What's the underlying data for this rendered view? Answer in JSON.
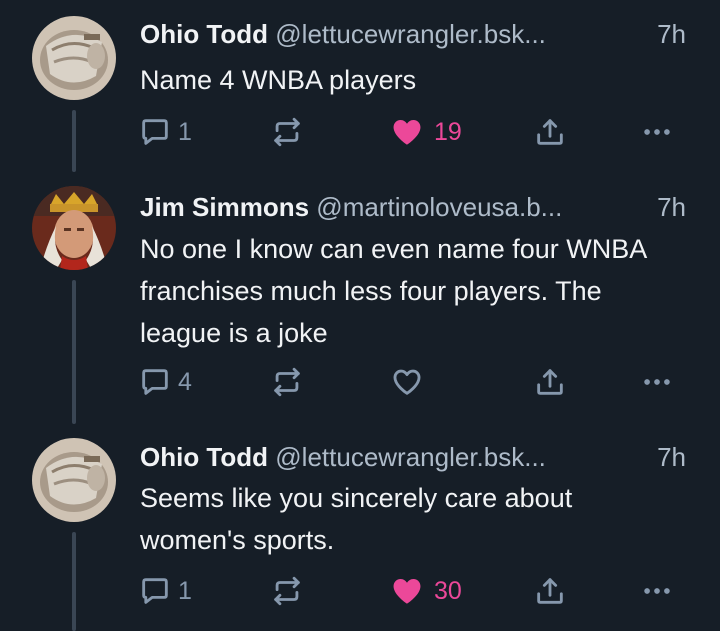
{
  "posts": [
    {
      "author": {
        "display_name": "Ohio Todd",
        "handle": "@lettucewrangler.bsk...",
        "avatar_icon": "avatar-icon"
      },
      "time": "7h",
      "text": "Name 4 WNBA players",
      "stats": {
        "replies": "1",
        "reposts": "",
        "likes": "19",
        "liked": true
      }
    },
    {
      "author": {
        "display_name": "Jim Simmons",
        "handle": "@martinoloveusa.b...",
        "avatar_icon": "avatar-icon"
      },
      "time": "7h",
      "text": "No one I know can even name four WNBA franchises much less four players. The league is a joke",
      "stats": {
        "replies": "4",
        "reposts": "",
        "likes": "",
        "liked": false
      }
    },
    {
      "author": {
        "display_name": "Ohio Todd",
        "handle": "@lettucewrangler.bsk...",
        "avatar_icon": "avatar-icon"
      },
      "time": "7h",
      "text": "Seems like you sincerely care about women's sports.",
      "stats": {
        "replies": "1",
        "reposts": "",
        "likes": "30",
        "liked": true
      }
    }
  ],
  "icons": {
    "reply": "reply-icon",
    "repost": "repost-icon",
    "like": "heart-icon",
    "share": "share-icon",
    "more": "more-icon"
  },
  "colors": {
    "background": "#161e27",
    "text": "#f1f3f5",
    "muted": "#aebbc9",
    "icon": "#8698ad",
    "like": "#ec4899",
    "thread_line": "#3a4654"
  }
}
